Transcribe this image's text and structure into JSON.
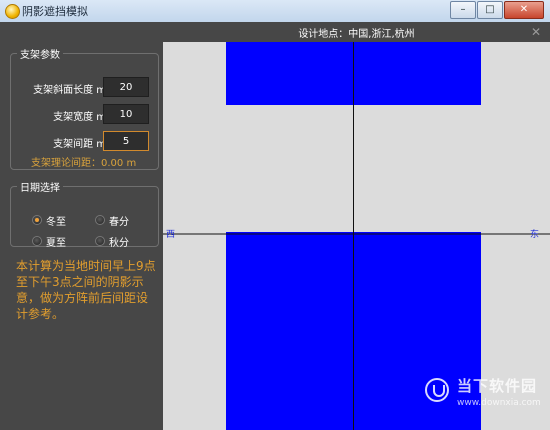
{
  "window": {
    "title": "阴影遮挡模拟",
    "buttons": {
      "minimize": "–",
      "maximize": "□",
      "close": "✕"
    }
  },
  "params": {
    "group_title": "支架参数",
    "rows": [
      {
        "label": "支架斜面长度 m",
        "value": "20"
      },
      {
        "label": "支架宽度 m",
        "value": "10"
      },
      {
        "label": "支架间距 m",
        "value": "5"
      }
    ],
    "theory_text": "支架理论间距：0.00 m"
  },
  "date": {
    "group_title": "日期选择",
    "options": [
      "冬至",
      "春分",
      "夏至",
      "秋分"
    ],
    "selected": "冬至"
  },
  "note": "本计算为当地时间早上9点至下午3点之间的阴影示意，做为方阵前后间距设计参考。",
  "canvas": {
    "title": "设计地点：中国,浙江,杭州",
    "close": "✕",
    "west_label": "西",
    "east_label": "东",
    "colors": {
      "background": "#dcdcdc",
      "panel": "#0000ff",
      "line": "#101010"
    }
  },
  "watermark": {
    "line1": "当下软件园",
    "line2": "www.downxia.com"
  }
}
